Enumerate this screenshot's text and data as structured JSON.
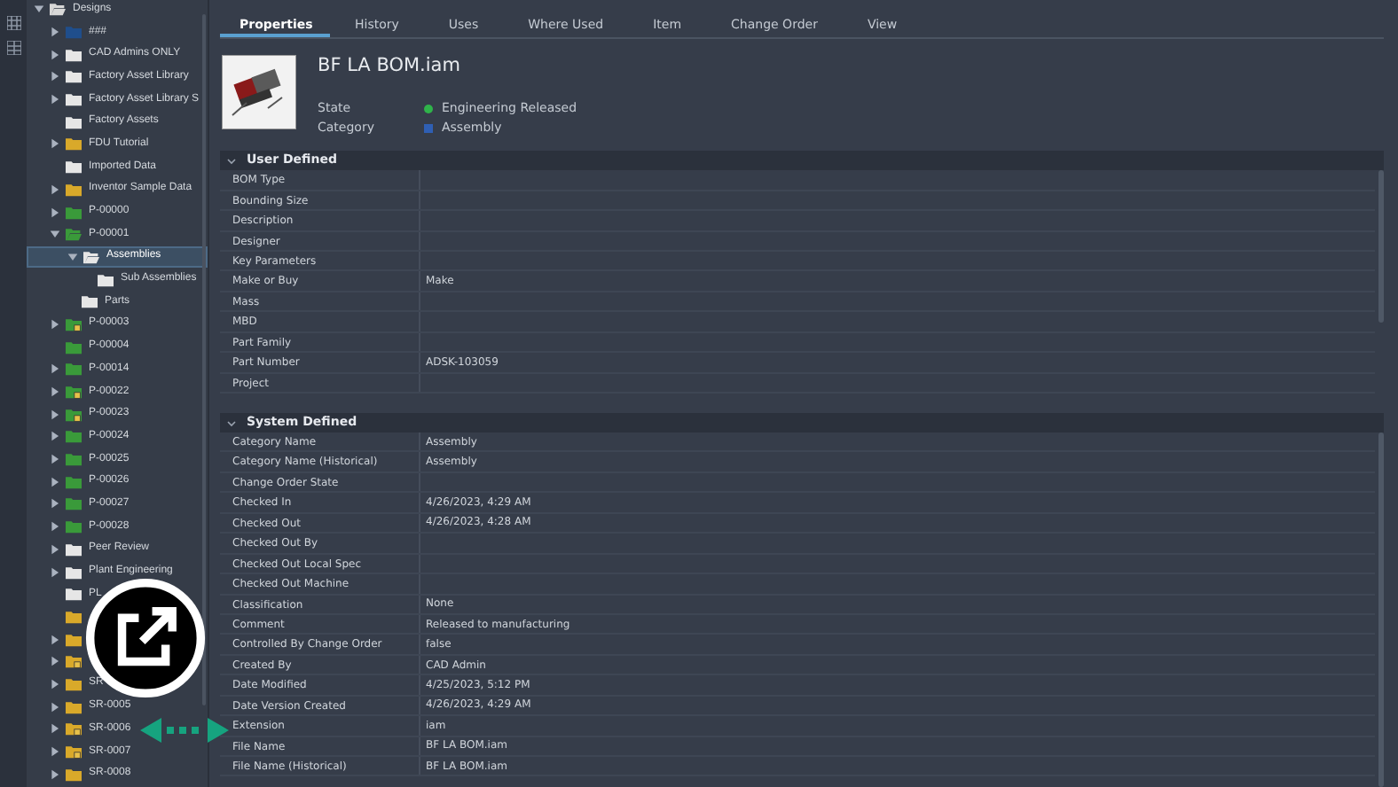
{
  "tree": [
    {
      "label": "Designs",
      "expandable": true,
      "expanded": true,
      "color": "#d8d8d8",
      "locked": false,
      "selected": false,
      "children": [
        {
          "label": "###",
          "expandable": true,
          "expanded": false,
          "color": "#1f4e8c",
          "locked": false,
          "selected": false
        },
        {
          "label": "CAD Admins ONLY",
          "expandable": true,
          "expanded": false,
          "color": "#e6e6e6",
          "locked": false,
          "selected": false
        },
        {
          "label": "Factory Asset Library",
          "expandable": true,
          "expanded": false,
          "color": "#e6e6e6",
          "locked": false,
          "selected": false
        },
        {
          "label": "Factory Asset Library S",
          "expandable": true,
          "expanded": false,
          "color": "#e6e6e6",
          "locked": false,
          "selected": false
        },
        {
          "label": "Factory Assets",
          "expandable": false,
          "expanded": false,
          "color": "#e6e6e6",
          "locked": false,
          "selected": false
        },
        {
          "label": "FDU Tutorial",
          "expandable": true,
          "expanded": false,
          "color": "#d9a92a",
          "locked": false,
          "selected": false
        },
        {
          "label": "Imported Data",
          "expandable": false,
          "expanded": false,
          "color": "#e6e6e6",
          "locked": false,
          "selected": false
        },
        {
          "label": "Inventor Sample Data",
          "expandable": true,
          "expanded": false,
          "color": "#d9a92a",
          "locked": false,
          "selected": false
        },
        {
          "label": "P-00000",
          "expandable": true,
          "expanded": false,
          "color": "#3a9a3a",
          "locked": false,
          "selected": false
        },
        {
          "label": "P-00001",
          "expandable": true,
          "expanded": true,
          "color": "#3a9a3a",
          "locked": false,
          "selected": false,
          "children": [
            {
              "label": "Assemblies",
              "expandable": true,
              "expanded": true,
              "color": "#e6e6e6",
              "locked": false,
              "selected": true,
              "children": [
                {
                  "label": "Sub Assemblies",
                  "expandable": false,
                  "expanded": false,
                  "color": "#e6e6e6",
                  "locked": false,
                  "selected": false
                }
              ]
            },
            {
              "label": "Parts",
              "expandable": false,
              "expanded": false,
              "color": "#e6e6e6",
              "locked": false,
              "selected": false
            }
          ]
        },
        {
          "label": "P-00003",
          "expandable": true,
          "expanded": false,
          "color": "#3a9a3a",
          "locked": true,
          "selected": false
        },
        {
          "label": "P-00004",
          "expandable": false,
          "expanded": false,
          "color": "#3a9a3a",
          "locked": false,
          "selected": false
        },
        {
          "label": "P-00014",
          "expandable": true,
          "expanded": false,
          "color": "#3a9a3a",
          "locked": false,
          "selected": false
        },
        {
          "label": "P-00022",
          "expandable": true,
          "expanded": false,
          "color": "#3a9a3a",
          "locked": true,
          "selected": false
        },
        {
          "label": "P-00023",
          "expandable": true,
          "expanded": false,
          "color": "#3a9a3a",
          "locked": true,
          "selected": false
        },
        {
          "label": "P-00024",
          "expandable": true,
          "expanded": false,
          "color": "#3a9a3a",
          "locked": false,
          "selected": false
        },
        {
          "label": "P-00025",
          "expandable": true,
          "expanded": false,
          "color": "#3a9a3a",
          "locked": false,
          "selected": false
        },
        {
          "label": "P-00026",
          "expandable": true,
          "expanded": false,
          "color": "#3a9a3a",
          "locked": false,
          "selected": false
        },
        {
          "label": "P-00027",
          "expandable": true,
          "expanded": false,
          "color": "#3a9a3a",
          "locked": false,
          "selected": false
        },
        {
          "label": "P-00028",
          "expandable": true,
          "expanded": false,
          "color": "#3a9a3a",
          "locked": false,
          "selected": false
        },
        {
          "label": "Peer Review",
          "expandable": true,
          "expanded": false,
          "color": "#e6e6e6",
          "locked": false,
          "selected": false
        },
        {
          "label": "Plant Engineering",
          "expandable": true,
          "expanded": false,
          "color": "#e6e6e6",
          "locked": false,
          "selected": false
        },
        {
          "label": "PL",
          "expandable": false,
          "expanded": false,
          "color": "#e6e6e6",
          "locked": false,
          "selected": false
        },
        {
          "expandable": false,
          "expanded": false,
          "color": "#d9a92a",
          "locked": false,
          "selected": false
        },
        {
          "expandable": true,
          "expanded": false,
          "color": "#d9a92a",
          "locked": false,
          "selected": false
        },
        {
          "expandable": true,
          "expanded": false,
          "color": "#d9a92a",
          "locked": true,
          "selected": false
        },
        {
          "label": "SR",
          "expandable": true,
          "expanded": false,
          "color": "#d9a92a",
          "locked": false,
          "selected": false
        },
        {
          "label": "SR-0005",
          "expandable": true,
          "expanded": false,
          "color": "#d9a92a",
          "locked": false,
          "selected": false
        },
        {
          "label": "SR-0006",
          "expandable": true,
          "expanded": false,
          "color": "#d9a92a",
          "locked": true,
          "selected": false
        },
        {
          "label": "SR-0007",
          "expandable": true,
          "expanded": false,
          "color": "#d9a92a",
          "locked": true,
          "selected": false
        },
        {
          "label": "SR-0008",
          "expandable": true,
          "expanded": false,
          "color": "#d9a92a",
          "locked": false,
          "selected": false
        }
      ]
    }
  ],
  "tabs": [
    {
      "label": "Properties",
      "selected": true
    },
    {
      "label": "History",
      "selected": false
    },
    {
      "label": "Uses",
      "selected": false
    },
    {
      "label": "Where Used",
      "selected": false
    },
    {
      "label": "Item",
      "selected": false
    },
    {
      "label": "Change Order",
      "selected": false
    },
    {
      "label": "View",
      "selected": false
    }
  ],
  "file": {
    "title": "BF LA BOM.iam",
    "fields": [
      {
        "label": "State",
        "value": "Engineering Released",
        "color": "#2fb34a"
      },
      {
        "label": "Category",
        "value": "Assembly",
        "color": "#2f5fb3"
      }
    ]
  },
  "sections": [
    {
      "title": "User Defined",
      "expanded": true,
      "rows": [
        {
          "name": "BOM Type"
        },
        {
          "name": "Bounding Size"
        },
        {
          "name": "Description"
        },
        {
          "name": "Designer"
        },
        {
          "name": "Key Parameters"
        },
        {
          "name": "Make or Buy",
          "value": "Make"
        },
        {
          "name": "Mass"
        },
        {
          "name": "MBD"
        },
        {
          "name": "Part Family"
        },
        {
          "name": "Part Number",
          "value": "ADSK-103059"
        },
        {
          "name": "Project"
        }
      ]
    },
    {
      "title": "System Defined",
      "expanded": true,
      "rows": [
        {
          "name": "Category Name",
          "value": "Assembly"
        },
        {
          "name": "Category Name (Historical)",
          "value": "Assembly"
        },
        {
          "name": "Change Order State"
        },
        {
          "name": "Checked In",
          "value": "4/26/2023, 4:29 AM"
        },
        {
          "name": "Checked Out",
          "value": "4/26/2023, 4:28 AM"
        },
        {
          "name": "Checked Out By"
        },
        {
          "name": "Checked Out Local Spec"
        },
        {
          "name": "Checked Out Machine"
        },
        {
          "name": "Classification",
          "value": "None"
        },
        {
          "name": "Comment",
          "value": "Released to manufacturing"
        },
        {
          "name": "Controlled By Change Order",
          "value": "false"
        },
        {
          "name": "Created By",
          "value": "CAD Admin"
        },
        {
          "name": "Date Modified",
          "value": "4/25/2023, 5:12 PM"
        },
        {
          "name": "Date Version Created",
          "value": "4/26/2023, 4:29 AM"
        },
        {
          "name": "Extension",
          "value": "iam"
        },
        {
          "name": "File Name",
          "value": "BF LA BOM.iam"
        },
        {
          "name": "File Name (Historical)",
          "value": "BF LA BOM.iam"
        }
      ]
    }
  ]
}
